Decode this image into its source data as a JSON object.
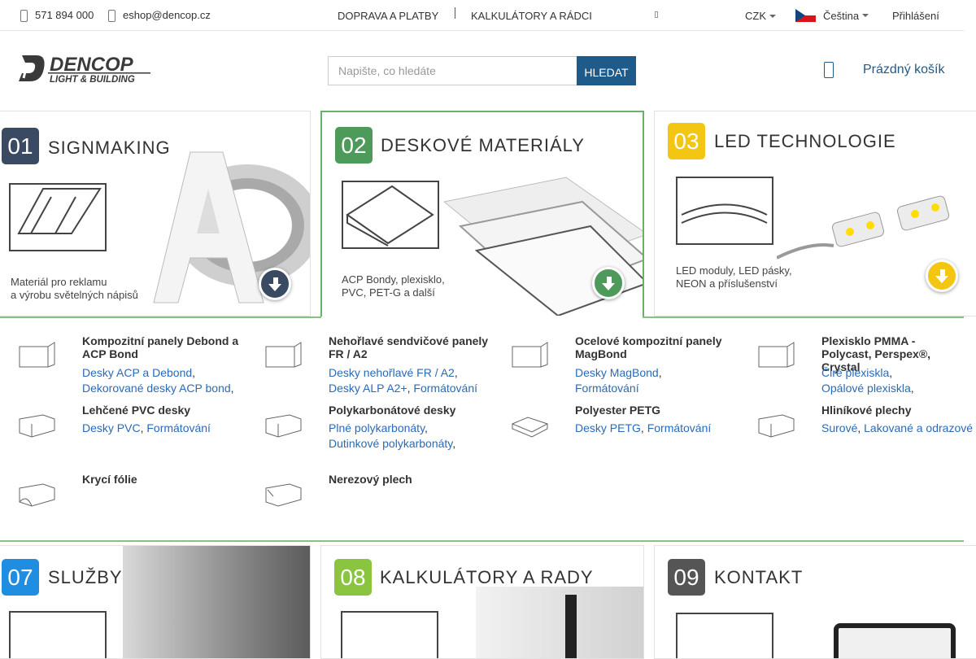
{
  "topbar": {
    "phone": "571 894 000",
    "email": "eshop@dencop.cz",
    "nav": [
      "DOPRAVA A PLATBY",
      "KALKULÁTORY A RÁDCI"
    ],
    "currency": "CZK",
    "language": "Čeština",
    "login": "Přihlášení"
  },
  "header": {
    "logo_main": "DENCOP",
    "logo_sub": "LIGHT & BUILDING",
    "search_placeholder": "Napište, co hledáte",
    "search_button": "HLEDAT",
    "cart_label": "Prázdný košík"
  },
  "banners": [
    {
      "number": "01",
      "title": "SIGNMAKING",
      "desc": "Materiál pro reklamu\na výrobu světelných nápisů",
      "color": "#3b4a63"
    },
    {
      "number": "02",
      "title": "DESKOVÉ MATERIÁLY",
      "desc": "ACP Bondy, plexisklo,\nPVC, PET-G a další",
      "color": "#4e9a5a"
    },
    {
      "number": "03",
      "title": "LED TECHNOLOGIE",
      "desc": "LED moduly, LED pásky,\nNEON a příslušenství",
      "color": "#f3c614"
    },
    {
      "number": "07",
      "title": "SLUŽBY",
      "color": "#1f8ee0"
    },
    {
      "number": "08",
      "title": "KALKULÁTORY A RADY",
      "color": "#8bc53f"
    },
    {
      "number": "09",
      "title": "KONTAKT",
      "color": "#555555"
    }
  ],
  "categories": [
    {
      "name": "Kompozitní panely Debond a ACP Bond",
      "links": [
        "Desky ACP a Debond",
        "Dekorované desky ACP bond"
      ]
    },
    {
      "name": "Nehořlavé sendvičové panely FR / A2",
      "links": [
        "Desky nehořlavé FR / A2",
        "Desky ALP A2+",
        "Formátování"
      ]
    },
    {
      "name": "Ocelové kompozitní panely MagBond",
      "links": [
        "Desky MagBond",
        "Formátování"
      ]
    },
    {
      "name": "Plexisklo PMMA - Polycast, Perspex®, Crystal",
      "links": [
        "Čiré plexiskla",
        "Opálové plexiskla"
      ]
    },
    {
      "name": "Lehčené PVC desky",
      "links": [
        "Desky PVC",
        "Formátování"
      ]
    },
    {
      "name": "Polykarbonátové desky",
      "links": [
        "Plné polykarbonáty",
        "Dutinkové polykarbonáty"
      ]
    },
    {
      "name": "Polyester PETG",
      "links": [
        "Desky PETG",
        "Formátování"
      ]
    },
    {
      "name": "Hliníkové plechy",
      "links": [
        "Surové",
        "Lakované a odrazové"
      ]
    },
    {
      "name": "Krycí fólie",
      "links": []
    },
    {
      "name": "Nerezový plech",
      "links": []
    }
  ]
}
